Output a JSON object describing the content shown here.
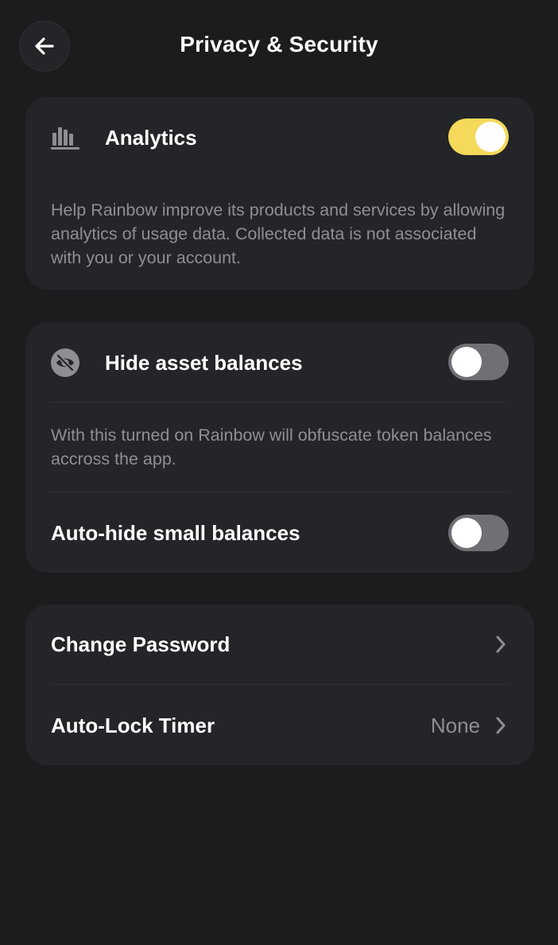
{
  "header": {
    "title": "Privacy & Security",
    "back_icon": "arrow-left-icon"
  },
  "analytics": {
    "icon": "bar-chart-icon",
    "label": "Analytics",
    "enabled": true,
    "description": "Help Rainbow improve its products and services by allowing analytics of usage data. Collected data is not associated with you or your account."
  },
  "balances": {
    "hide_icon": "eye-slash-icon",
    "hide_label": "Hide asset balances",
    "hide_enabled": false,
    "hide_description": "With this turned on Rainbow will obfuscate token balances accross the app.",
    "auto_hide_label": "Auto-hide small balances",
    "auto_hide_enabled": false
  },
  "security": {
    "change_password_label": "Change Password",
    "auto_lock_label": "Auto-Lock Timer",
    "auto_lock_value": "None",
    "chevron_icon": "chevron-right-icon"
  },
  "colors": {
    "background": "#1b1c1e",
    "card": "#242528",
    "toggle_on": "#f5d95b",
    "toggle_off": "#6f7074",
    "secondary_text": "#8d8f94"
  }
}
